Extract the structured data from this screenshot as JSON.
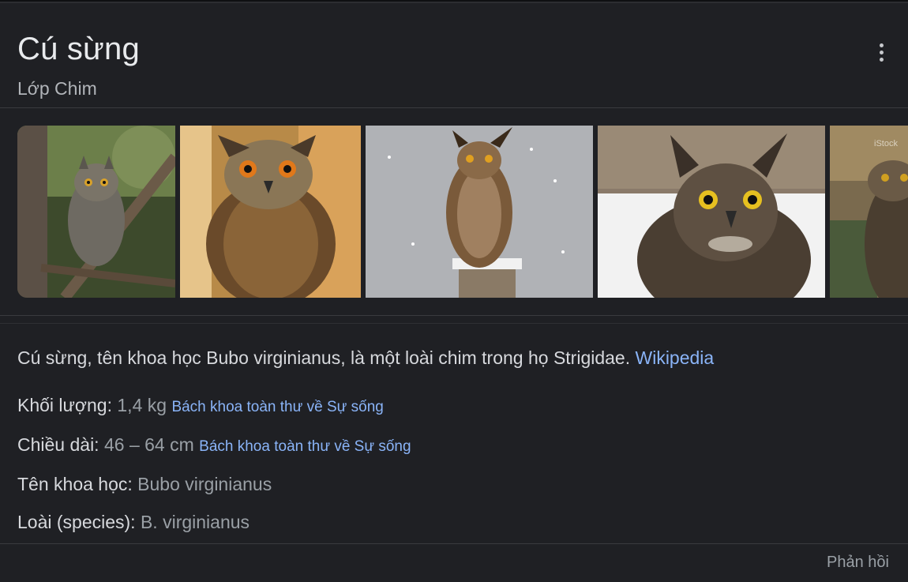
{
  "header": {
    "title": "Cú sừng",
    "subtitle": "Lớp Chim"
  },
  "images": [
    {
      "subject": "great horned owl perched among branches",
      "palette": "#5a6b3c"
    },
    {
      "subject": "eurasian eagle owl indoors",
      "palette": "#b08a4a"
    },
    {
      "subject": "great horned owl on stump in snow",
      "palette": "#a9aaae"
    },
    {
      "subject": "great horned owl close-up",
      "palette": "#c9c8c4"
    },
    {
      "subject": "great horned owl stock photo",
      "palette": "#6b5a3c",
      "watermark": "iStock"
    }
  ],
  "description": {
    "text": "Cú sừng, tên khoa học Bubo virginianus, là một loài chim trong họ Strigidae. ",
    "source": "Wikipedia"
  },
  "facts": [
    {
      "label": "Khối lượng: ",
      "value": "1,4 kg",
      "source": "Bách khoa toàn thư về Sự sống"
    },
    {
      "label": "Chiều dài: ",
      "value": "46 – 64 cm",
      "source": "Bách khoa toàn thư về Sự sống"
    },
    {
      "label": "Tên khoa học: ",
      "value": "Bubo virginianus",
      "source": ""
    },
    {
      "label": "Loài (species): ",
      "value": "B. virginianus",
      "source": ""
    }
  ],
  "footer": {
    "feedback_label": "Phản hồi"
  },
  "colors": {
    "background": "#1f2024",
    "link": "#8ab4f8",
    "text": "#d7d9dd",
    "muted": "#9aa0a6"
  }
}
